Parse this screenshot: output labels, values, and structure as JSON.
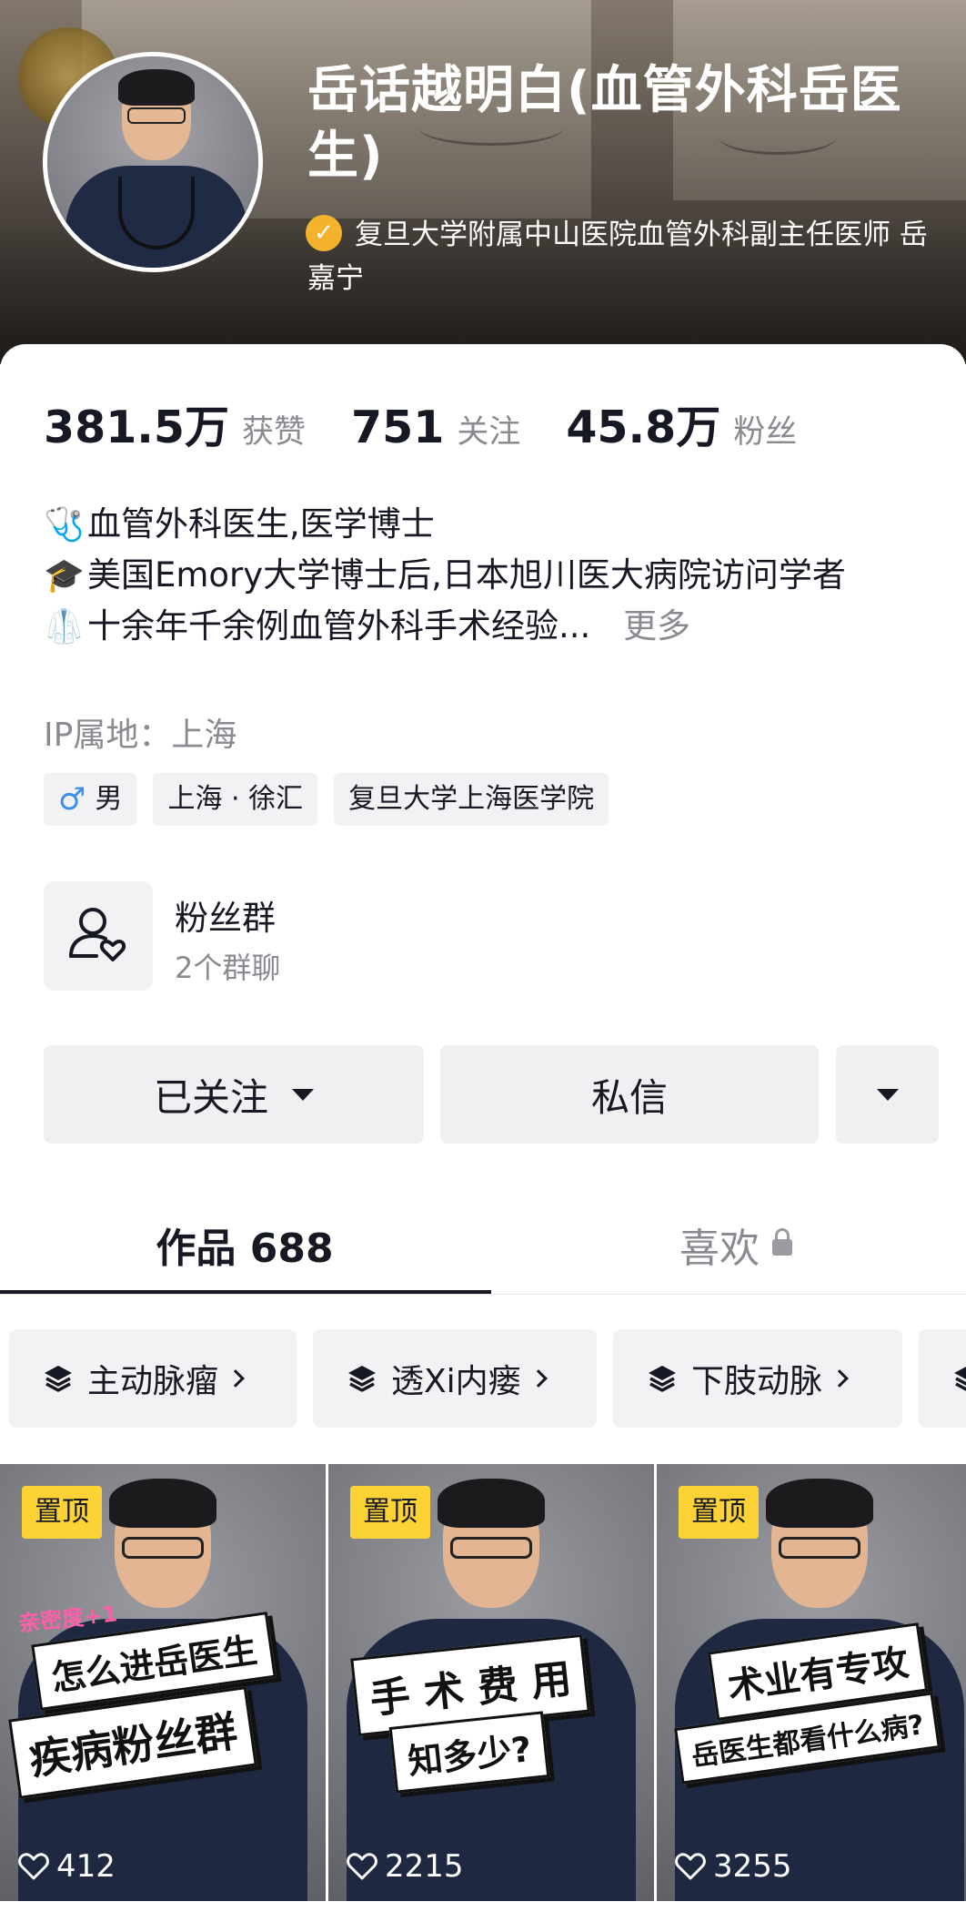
{
  "profile": {
    "name": "岳话越明白(血管外科岳医生)",
    "verify_mark": "✓",
    "verification": "复旦大学附属中山医院血管外科副主任医师 岳嘉宁"
  },
  "stats": [
    {
      "value": "381.5万",
      "label": "获赞"
    },
    {
      "value": "751",
      "label": "关注"
    },
    {
      "value": "45.8万",
      "label": "粉丝"
    }
  ],
  "bio": {
    "lines": [
      {
        "icon": "🩺",
        "text": "血管外科医生,医学博士"
      },
      {
        "icon": "🎓",
        "text": "美国Emory大学博士后,日本旭川医大病院访问学者"
      },
      {
        "icon": "🥼",
        "text": "十余年千余例血管外科手术经验..."
      }
    ],
    "more_label": "更多",
    "ip_location": "IP属地：上海"
  },
  "tags": {
    "gender_symbol": "♂",
    "gender": "男",
    "location": "上海 · 徐汇",
    "school": "复旦大学上海医学院"
  },
  "fan_group": {
    "title": "粉丝群",
    "subtitle": "2个群聊"
  },
  "actions": {
    "follow_label": "已关注",
    "message_label": "私信"
  },
  "tabs": {
    "works_label": "作品 688",
    "likes_label": "喜欢"
  },
  "collections": [
    {
      "label": "主动脉瘤"
    },
    {
      "label": "透Xi内瘘"
    },
    {
      "label": "下肢动脉"
    }
  ],
  "videos": [
    {
      "pin_label": "置顶",
      "likes": "412",
      "line1": "怎么进岳医生",
      "line2": "疾病粉丝群",
      "badge": "亲密度+1"
    },
    {
      "pin_label": "置顶",
      "likes": "2215",
      "line1": "手 术 费 用",
      "line2": "知多少?"
    },
    {
      "pin_label": "置顶",
      "likes": "3255",
      "line1": "术业有专攻",
      "line2": "岳医生都看什么病?"
    }
  ],
  "colors": {
    "accent_pin": "#fdd234",
    "verify": "#f5b22d",
    "male": "#3a8ff0",
    "text_primary": "#161823",
    "text_secondary": "#8a8b91"
  }
}
